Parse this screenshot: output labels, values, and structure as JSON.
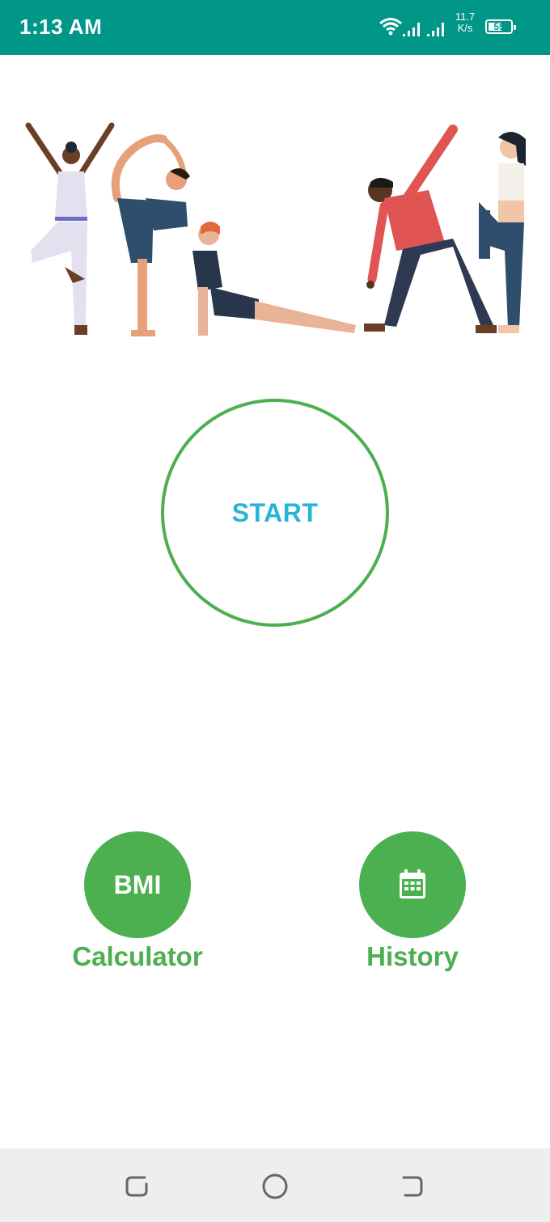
{
  "status_bar": {
    "time": "1:13 AM",
    "network_speed_value": "11.7",
    "network_speed_unit": "K/s",
    "battery_level": "55",
    "background_color": "#009688"
  },
  "hero": {
    "icon": "yoga-illustration"
  },
  "main": {
    "start_label": "START",
    "start_color": "#26b5d6",
    "ring_color": "#4caf50"
  },
  "actions": {
    "bmi_label": "BMI",
    "bmi_caption": "Calculator",
    "history_icon": "calendar-icon",
    "history_caption": "History",
    "accent_color": "#4caf50"
  },
  "nav_bar": {
    "recent_icon": "recent-apps-icon",
    "home_icon": "home-icon",
    "back_icon": "back-icon"
  }
}
